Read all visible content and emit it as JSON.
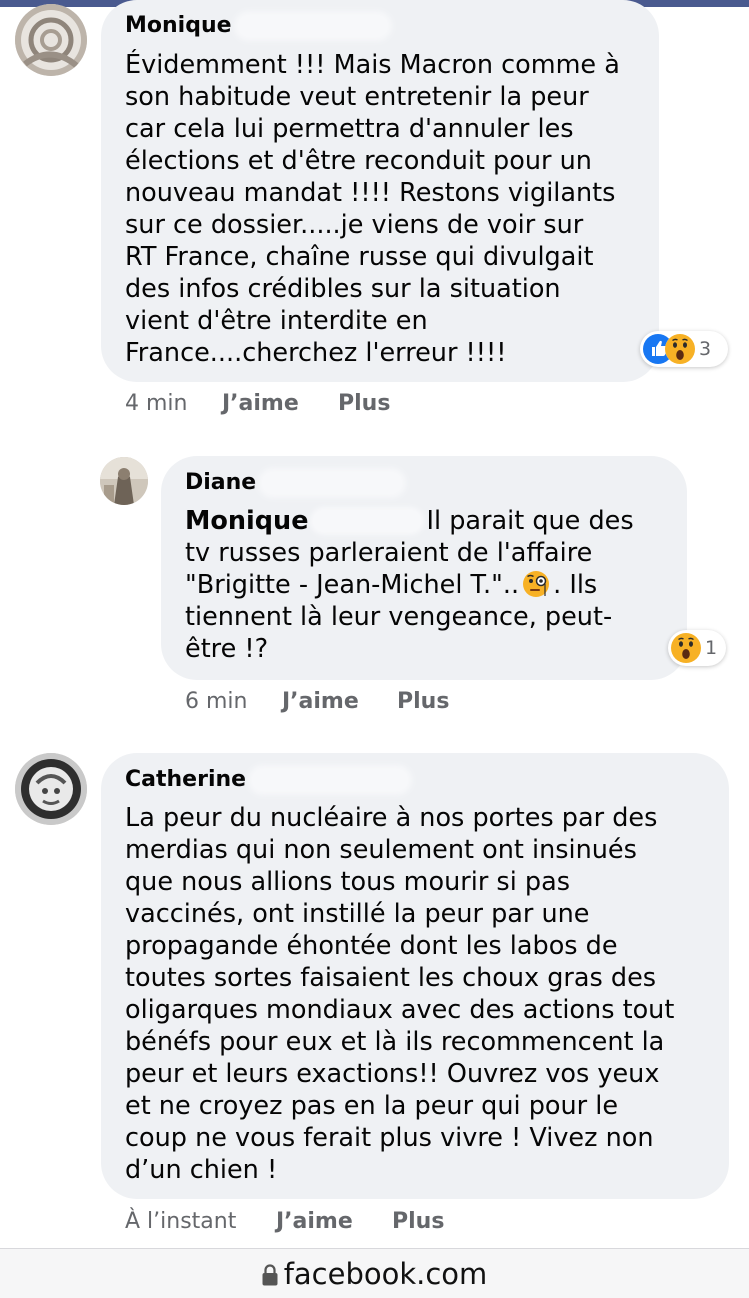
{
  "comments": [
    {
      "author": "Monique",
      "lines": [
        "Évidemment !!! Mais Macron comme à",
        "son habitude veut entretenir la peur",
        "car cela lui permettra d'annuler les",
        "élections et d'être reconduit pour un",
        "nouveau mandat !!!! Restons vigilants",
        "sur ce dossier.....je viens de voir sur",
        "RT France, chaîne russe qui divulgait",
        "des infos crédibles sur la situation",
        "vient d'être interdite en",
        "France....cherchez l'erreur !!!!"
      ],
      "reactions": {
        "icons": [
          "like-icon",
          "wow-icon"
        ],
        "count": "3"
      },
      "time": "4 min",
      "like_label": "J’aime",
      "more_label": "Plus"
    },
    {
      "author": "Diane",
      "mention": "Monique",
      "first_line_rest": "Il parait que des",
      "lines": [
        "tv russes parleraient de l'affaire"
      ],
      "line3_before": "\"Brigitte - Jean-Michel T.\"..",
      "line3_emoji": "face-with-monocle-icon",
      "line3_after": ". Ils",
      "lines_after": [
        "tiennent là leur vengeance, peut-",
        "être !?"
      ],
      "reactions": {
        "icons": [
          "wow-icon"
        ],
        "count": "1"
      },
      "time": "6 min",
      "like_label": "J’aime",
      "more_label": "Plus"
    },
    {
      "author": "Catherine",
      "lines": [
        "La peur du nucléaire à nos portes par des",
        "merdias qui non seulement ont insinués",
        "que nous allions tous mourir si pas",
        "vaccinés, ont instillé la peur par une",
        "propagande éhontée dont les labos de",
        "toutes sortes faisaient les choux gras des",
        "oligarques mondiaux avec des actions tout",
        "bénéfs pour eux et là ils recommencent la",
        "peur et leurs exactions!! Ouvrez vos yeux",
        "et ne croyez pas en la peur qui pour le",
        "coup ne vous ferait plus vivre ! Vivez non",
        "d’un chien !"
      ],
      "time": "À l’instant",
      "like_label": "J’aime",
      "more_label": "Plus"
    }
  ],
  "browser": {
    "url": "facebook.com",
    "icon": "lock-icon"
  },
  "colors": {
    "bubble": "#eff1f4",
    "meta_text": "#65676b",
    "like_blue": "#1877f2",
    "wow_yellow": "#f7b125"
  }
}
